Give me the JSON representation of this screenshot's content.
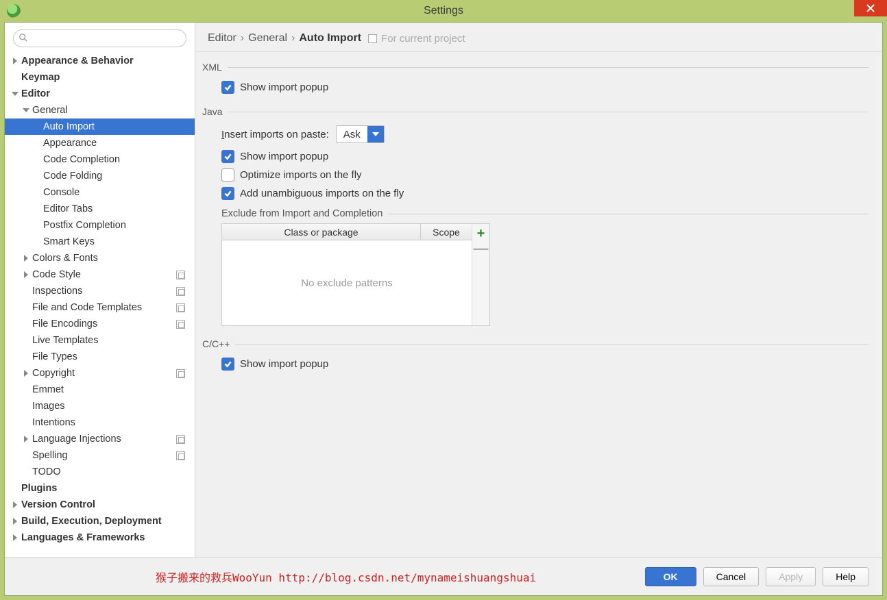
{
  "window": {
    "title": "Settings"
  },
  "breadcrumb": {
    "items": [
      "Editor",
      "General",
      "Auto Import"
    ],
    "hint": "For current project"
  },
  "sidebar": {
    "items": [
      {
        "label": "Appearance & Behavior",
        "level": 0,
        "bold": true,
        "arrow": "right"
      },
      {
        "label": "Keymap",
        "level": 0,
        "bold": true
      },
      {
        "label": "Editor",
        "level": 0,
        "bold": true,
        "arrow": "down"
      },
      {
        "label": "General",
        "level": 1,
        "arrow": "down"
      },
      {
        "label": "Auto Import",
        "level": 2,
        "selected": true
      },
      {
        "label": "Appearance",
        "level": 2
      },
      {
        "label": "Code Completion",
        "level": 2
      },
      {
        "label": "Code Folding",
        "level": 2
      },
      {
        "label": "Console",
        "level": 2
      },
      {
        "label": "Editor Tabs",
        "level": 2
      },
      {
        "label": "Postfix Completion",
        "level": 2
      },
      {
        "label": "Smart Keys",
        "level": 2
      },
      {
        "label": "Colors & Fonts",
        "level": 1,
        "arrow": "right"
      },
      {
        "label": "Code Style",
        "level": 1,
        "arrow": "right",
        "proj": true
      },
      {
        "label": "Inspections",
        "level": 1,
        "proj": true
      },
      {
        "label": "File and Code Templates",
        "level": 1,
        "proj": true
      },
      {
        "label": "File Encodings",
        "level": 1,
        "proj": true
      },
      {
        "label": "Live Templates",
        "level": 1
      },
      {
        "label": "File Types",
        "level": 1
      },
      {
        "label": "Copyright",
        "level": 1,
        "arrow": "right",
        "proj": true
      },
      {
        "label": "Emmet",
        "level": 1
      },
      {
        "label": "Images",
        "level": 1
      },
      {
        "label": "Intentions",
        "level": 1
      },
      {
        "label": "Language Injections",
        "level": 1,
        "arrow": "right",
        "proj": true
      },
      {
        "label": "Spelling",
        "level": 1,
        "proj": true
      },
      {
        "label": "TODO",
        "level": 1
      },
      {
        "label": "Plugins",
        "level": 0,
        "bold": true
      },
      {
        "label": "Version Control",
        "level": 0,
        "bold": true,
        "arrow": "right"
      },
      {
        "label": "Build, Execution, Deployment",
        "level": 0,
        "bold": true,
        "arrow": "right"
      },
      {
        "label": "Languages & Frameworks",
        "level": 0,
        "bold": true,
        "arrow": "right"
      }
    ]
  },
  "groups": {
    "xml": {
      "title": "XML",
      "show_popup": "Show import popup"
    },
    "java": {
      "title": "Java",
      "insert_label": "Insert imports on paste:",
      "insert_value": "Ask",
      "show_popup": "Show import popup",
      "optimize": "Optimize imports on the fly",
      "unambiguous": "Add unambiguous imports on the fly",
      "exclude_title": "Exclude from Import and Completion",
      "col1": "Class or package",
      "col2": "Scope",
      "empty": "No exclude patterns"
    },
    "cpp": {
      "title": "C/C++",
      "show_popup": "Show import popup"
    }
  },
  "footer": {
    "watermark": "猴子搬来的救兵WooYun http://blog.csdn.net/mynameishuangshuai",
    "ok": "OK",
    "cancel": "Cancel",
    "apply": "Apply",
    "help": "Help"
  }
}
